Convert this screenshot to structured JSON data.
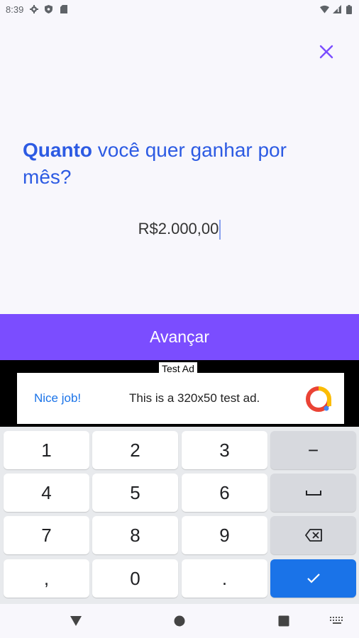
{
  "status_bar": {
    "time": "8:39",
    "left_icons": [
      "gear-icon",
      "shield-icon",
      "sim-card-icon"
    ],
    "right_icons": [
      "wifi-icon",
      "signal-icon",
      "battery-icon"
    ]
  },
  "header": {
    "close_icon": "close-icon"
  },
  "question": {
    "strong": "Quanto",
    "rest": " você quer ganhar por mês?"
  },
  "amount": {
    "value": "R$2.000,00"
  },
  "advance_button": {
    "label": "Avançar"
  },
  "ad": {
    "badge": "Test Ad",
    "nice": "Nice job!",
    "text": "This is a 320x50 test ad.",
    "logo_icon": "admob-logo-icon"
  },
  "keyboard": {
    "keys": [
      [
        "1",
        "2",
        "3",
        "−"
      ],
      [
        "4",
        "5",
        "6",
        "␣"
      ],
      [
        "7",
        "8",
        "9",
        "⌫"
      ],
      [
        ",",
        "0",
        ".",
        "✓"
      ]
    ]
  },
  "nav_bar": {
    "icons": [
      "back-icon",
      "home-icon",
      "recents-icon",
      "keyboard-switch-icon"
    ]
  },
  "colors": {
    "accent": "#7b4dff",
    "question_blue": "#2d5be3",
    "enter_key": "#1a73e8"
  }
}
